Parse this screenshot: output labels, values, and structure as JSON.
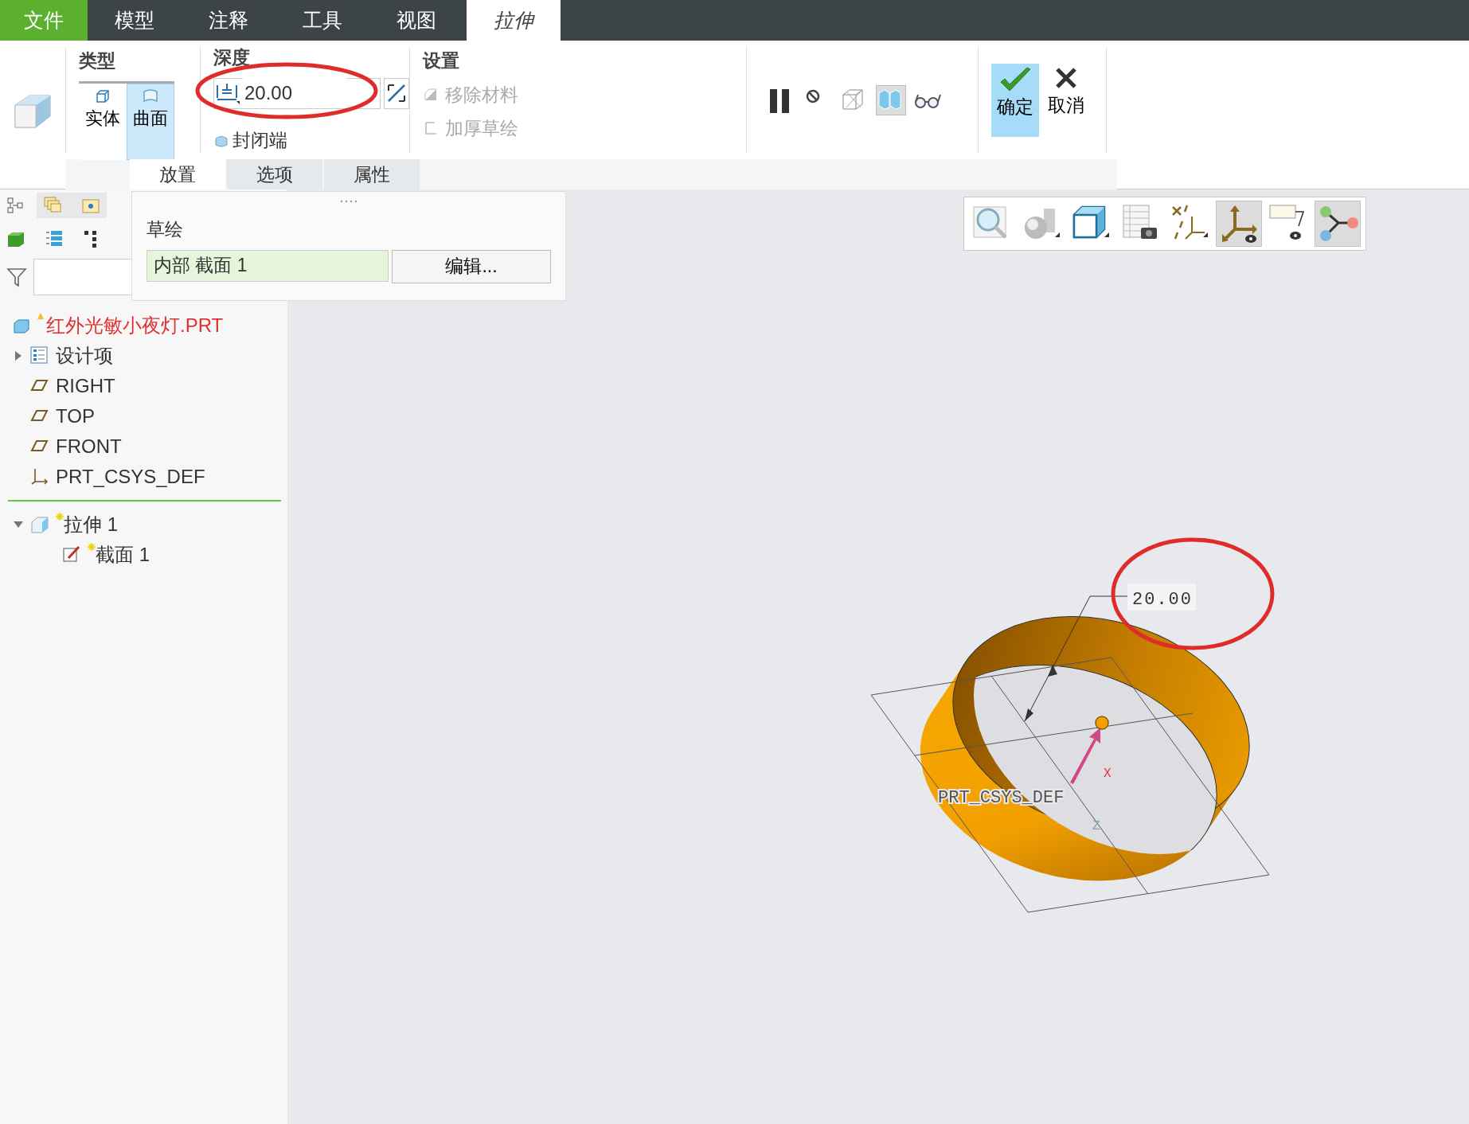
{
  "ribbon_tabs": [
    {
      "label": "文件",
      "kind": "file",
      "selected": false
    },
    {
      "label": "模型",
      "kind": "tab",
      "selected": false
    },
    {
      "label": "注释",
      "kind": "tab",
      "selected": false
    },
    {
      "label": "工具",
      "kind": "tab",
      "selected": false
    },
    {
      "label": "视图",
      "kind": "tab",
      "selected": false
    },
    {
      "label": "拉伸",
      "kind": "tab",
      "selected": true
    }
  ],
  "ribbon": {
    "type_group": {
      "title": "类型",
      "options": [
        {
          "label": "实体",
          "kind": "solid",
          "selected": false
        },
        {
          "label": "曲面",
          "kind": "surface",
          "selected": true
        }
      ]
    },
    "depth_group": {
      "title": "深度",
      "value": "20.00",
      "capped_ends": {
        "label": "封闭端"
      }
    },
    "settings_group": {
      "title": "设置",
      "options": [
        {
          "label": "移除材料",
          "kind": "remove",
          "disabled": true
        },
        {
          "label": "加厚草绘",
          "kind": "thicken",
          "disabled": true
        }
      ]
    },
    "control_icons": [
      {
        "kind": "pause",
        "selected": false
      },
      {
        "kind": "stop",
        "selected": false
      },
      {
        "kind": "wireframe",
        "selected": false
      },
      {
        "kind": "preview",
        "selected": true
      },
      {
        "kind": "glasses",
        "selected": false
      }
    ],
    "ok": {
      "label": "确定",
      "selected": true
    },
    "cancel": {
      "label": "取消"
    }
  },
  "sub_tabs": [
    {
      "label": "放置",
      "selected": true
    },
    {
      "label": "选项",
      "selected": false
    },
    {
      "label": "属性",
      "selected": false
    }
  ],
  "placement_panel": {
    "title": "草绘",
    "sketch": "内部 截面 1",
    "edit_button": "编辑..."
  },
  "model_tree": {
    "root": {
      "label": "红外光敏小夜灯.PRT",
      "modified": true
    },
    "items": [
      {
        "label": "设计项",
        "kind": "folder",
        "expanded": false
      },
      {
        "label": "RIGHT",
        "kind": "plane"
      },
      {
        "label": "TOP",
        "kind": "plane"
      },
      {
        "label": "FRONT",
        "kind": "plane"
      },
      {
        "label": "PRT_CSYS_DEF",
        "kind": "csys"
      }
    ],
    "features": [
      {
        "label": "拉伸 1",
        "kind": "extrude",
        "new": true,
        "expanded": true,
        "children": [
          {
            "label": "截面 1",
            "kind": "sketch",
            "new": true
          }
        ]
      }
    ]
  },
  "view_toolbar": [
    {
      "kind": "zoom",
      "selected": false
    },
    {
      "kind": "shade",
      "selected": false
    },
    {
      "kind": "cube",
      "selected": false
    },
    {
      "kind": "table",
      "selected": false
    },
    {
      "kind": "datum",
      "selected": false
    },
    {
      "kind": "csys",
      "selected": true
    },
    {
      "kind": "note",
      "selected": false
    },
    {
      "kind": "spin",
      "selected": true
    }
  ],
  "viewport": {
    "dimension": "20.00",
    "csys_label": "PRT_CSYS_DEF",
    "axis_x": "X",
    "axis_z": "Z"
  },
  "markup_circles": [
    {
      "kind": "ellipse"
    },
    {
      "kind": "ellipse"
    }
  ]
}
